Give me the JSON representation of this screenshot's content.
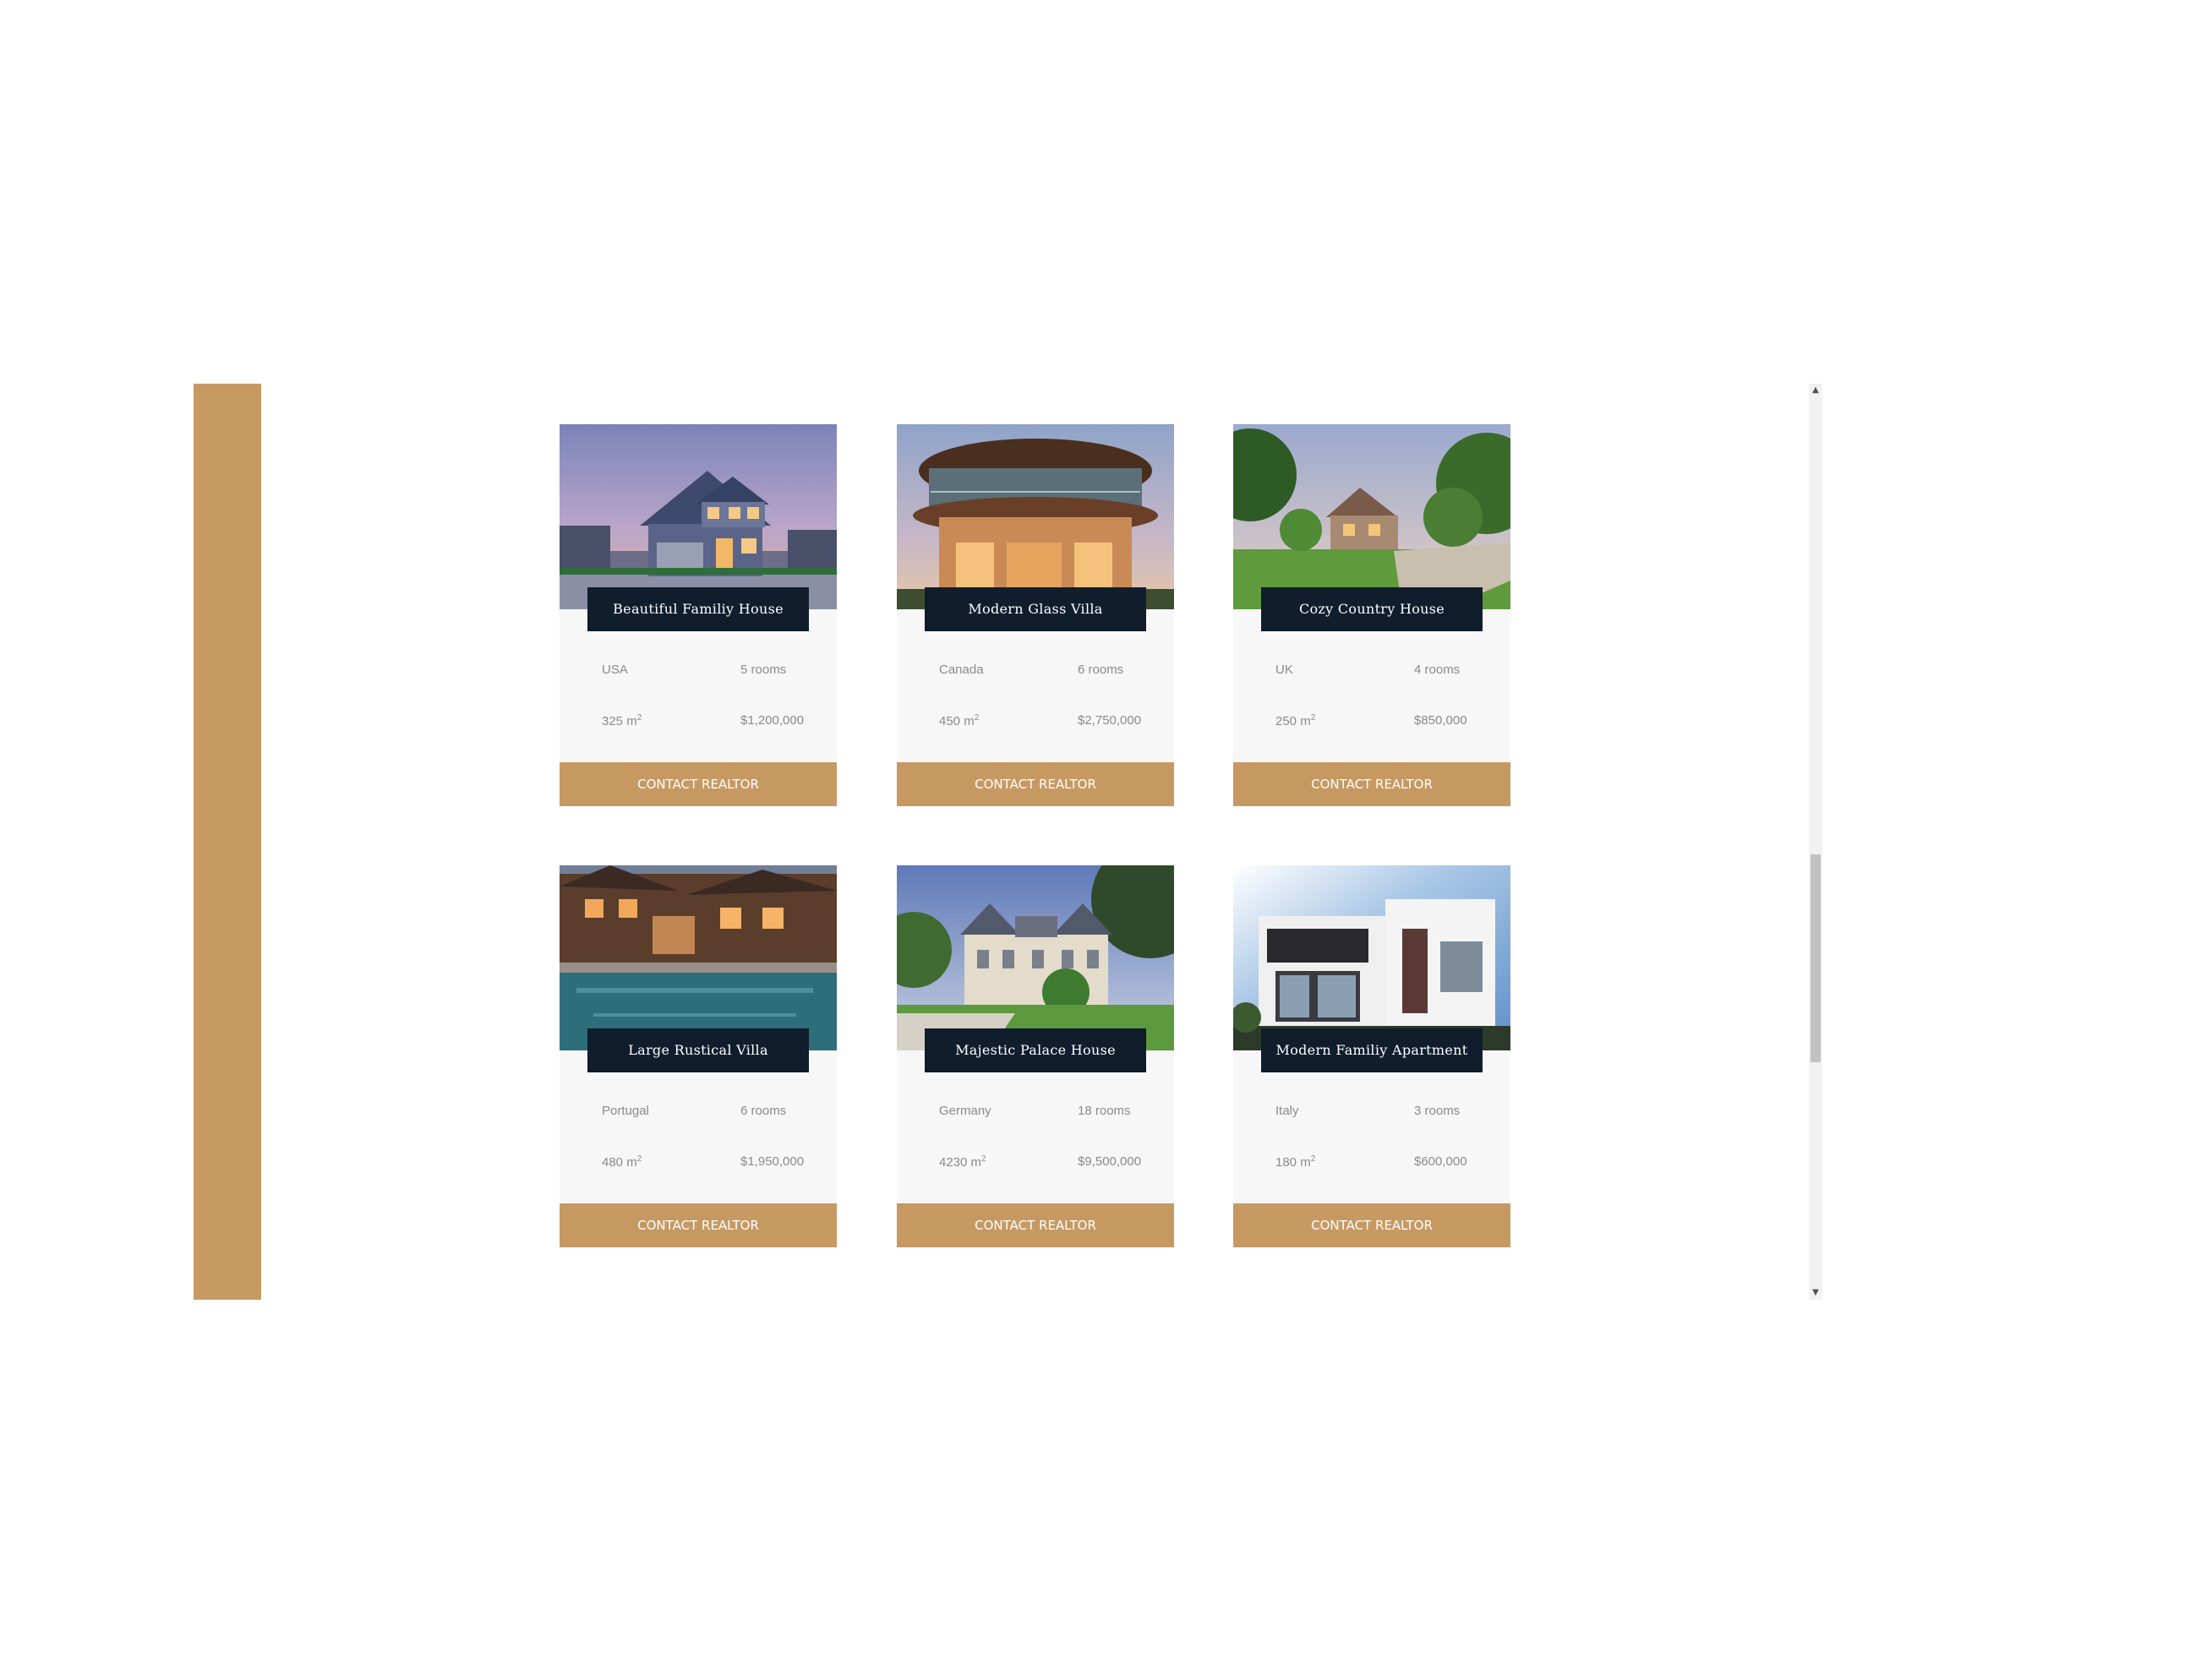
{
  "colors": {
    "accent_gold": "#c69963",
    "name_label_bg": "#101d2c",
    "card_bg": "#f7f7f7"
  },
  "scrollbar": {
    "up_arrow": "▲",
    "down_arrow": "▼"
  },
  "homes": [
    {
      "name": "Beautiful Familiy House",
      "country": "USA",
      "rooms": "5 rooms",
      "area": "325 m",
      "area_unit_exp": "2",
      "price": "$1,200,000",
      "button_label": "CONTACT REALTOR",
      "photo_icon": "house-photo"
    },
    {
      "name": "Modern Glass Villa",
      "country": "Canada",
      "rooms": "6 rooms",
      "area": "450 m",
      "area_unit_exp": "2",
      "price": "$2,750,000",
      "button_label": "CONTACT REALTOR",
      "photo_icon": "villa-photo"
    },
    {
      "name": "Cozy Country House",
      "country": "UK",
      "rooms": "4 rooms",
      "area": "250 m",
      "area_unit_exp": "2",
      "price": "$850,000",
      "button_label": "CONTACT REALTOR",
      "photo_icon": "country-house-photo"
    },
    {
      "name": "Large Rustical Villa",
      "country": "Portugal",
      "rooms": "6 rooms",
      "area": "480 m",
      "area_unit_exp": "2",
      "price": "$1,950,000",
      "button_label": "CONTACT REALTOR",
      "photo_icon": "rustic-villa-photo"
    },
    {
      "name": "Majestic Palace House",
      "country": "Germany",
      "rooms": "18 rooms",
      "area": "4230 m",
      "area_unit_exp": "2",
      "price": "$9,500,000",
      "button_label": "CONTACT REALTOR",
      "photo_icon": "palace-photo"
    },
    {
      "name": "Modern Familiy Apartment",
      "country": "Italy",
      "rooms": "3 rooms",
      "area": "180 m",
      "area_unit_exp": "2",
      "price": "$600,000",
      "button_label": "CONTACT REALTOR",
      "photo_icon": "apartment-photo"
    }
  ]
}
